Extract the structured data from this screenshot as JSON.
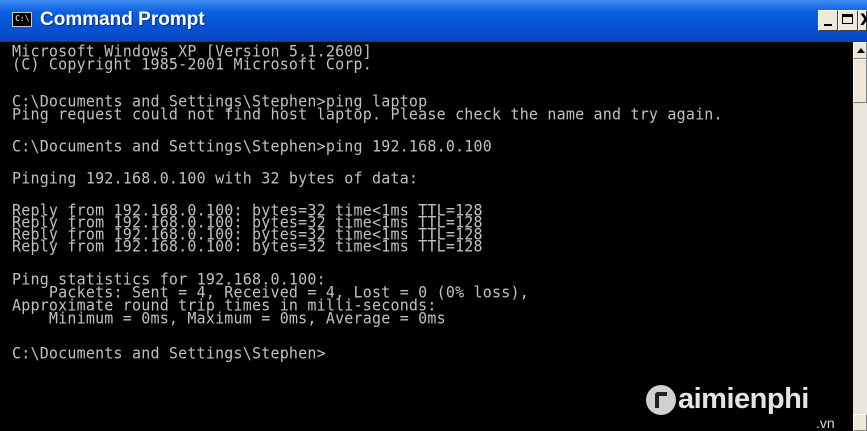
{
  "window": {
    "title": "Command Prompt",
    "icon": "console-icon",
    "icon_glyph": "C:\\",
    "controls": {
      "minimize": "minimize-icon",
      "maximize": "maximize-icon",
      "close": "close-icon",
      "close_glyph": "X"
    },
    "title_gradient": [
      "#3f8cf3",
      "#0553d6"
    ],
    "console_background": "#000000",
    "console_text_color": "#c0c0c0"
  },
  "console": {
    "lines": [
      "Microsoft Windows XP [Version 5.1.2600]",
      "(C) Copyright 1985-2001 Microsoft Corp.",
      "",
      "C:\\Documents and Settings\\Stephen>ping laptop",
      "Ping request could not find host laptop. Please check the name and try again.",
      "",
      "C:\\Documents and Settings\\Stephen>ping 192.168.0.100",
      "",
      "Pinging 192.168.0.100 with 32 bytes of data:",
      "",
      "Reply from 192.168.0.100: bytes=32 time<1ms TTL=128",
      "Reply from 192.168.0.100: bytes=32 time<1ms TTL=128",
      "Reply from 192.168.0.100: bytes=32 time<1ms TTL=128",
      "Reply from 192.168.0.100: bytes=32 time<1ms TTL=128",
      "",
      "Ping statistics for 192.168.0.100:",
      "    Packets: Sent = 4, Received = 4, Lost = 0 (0% loss),",
      "Approximate round trip times in milli-seconds:",
      "    Minimum = 0ms, Maximum = 0ms, Average = 0ms",
      "",
      "C:\\Documents and Settings\\Stephen>"
    ]
  },
  "watermark": {
    "brand": "aimienphi",
    "suffix": ".vn"
  }
}
